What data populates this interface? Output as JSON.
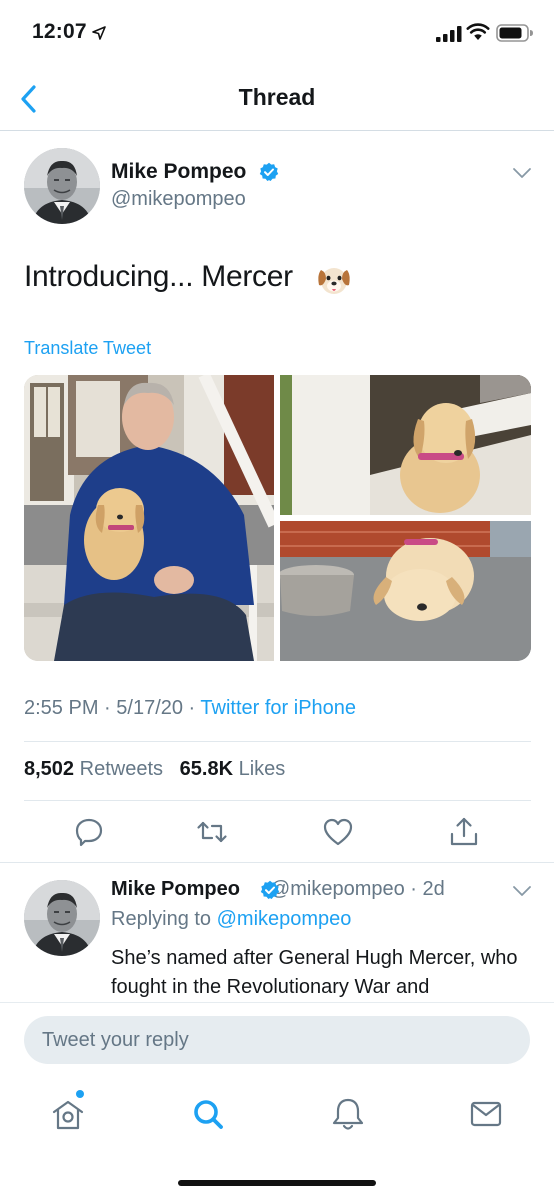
{
  "status_bar": {
    "time": "12:07"
  },
  "nav": {
    "title": "Thread"
  },
  "tweet": {
    "author_name": "Mike Pompeo",
    "author_handle": "@mikepompeo",
    "text": "Introducing... Mercer",
    "translate_label": "Translate Tweet",
    "time": "2:55 PM",
    "date": "5/17/20",
    "source": "Twitter for iPhone",
    "retweets_count": "8,502",
    "retweets_label": "Retweets",
    "likes_count": "65.8K",
    "likes_label": "Likes"
  },
  "reply": {
    "author_name": "Mike Pompeo",
    "author_handle": "@mikepompeo",
    "age": "2d",
    "replying_prefix": "Replying to",
    "replying_handle": "@mikepompeo",
    "text": "She’s named after General Hugh Mercer, who fought in the Revolutionary War and"
  },
  "composer": {
    "placeholder": "Tweet your reply"
  },
  "colors": {
    "accent": "#1da1f2",
    "secondary_text": "#657786",
    "divider": "#e1e8ed"
  }
}
